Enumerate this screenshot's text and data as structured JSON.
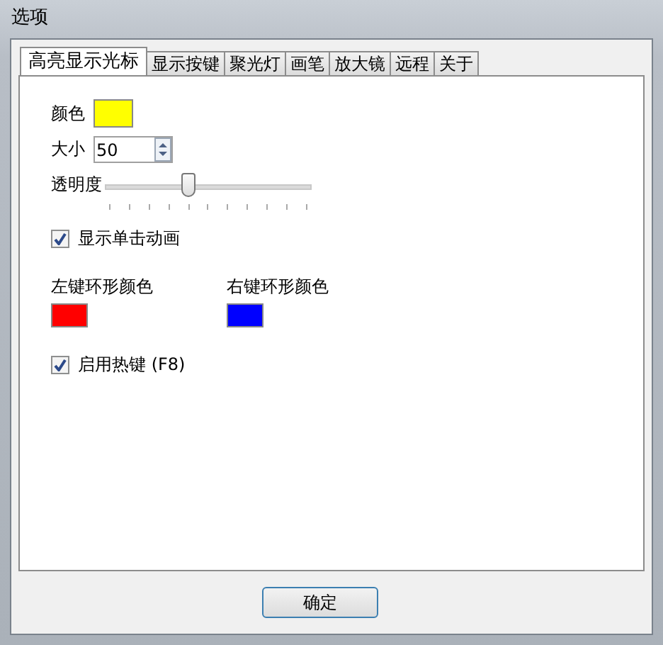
{
  "window": {
    "title": "选项"
  },
  "tabs": [
    {
      "label": "高亮显示光标",
      "selected": true
    },
    {
      "label": "显示按键",
      "selected": false
    },
    {
      "label": "聚光灯",
      "selected": false
    },
    {
      "label": "画笔",
      "selected": false
    },
    {
      "label": "放大镜",
      "selected": false
    },
    {
      "label": "远程",
      "selected": false
    },
    {
      "label": "关于",
      "selected": false
    }
  ],
  "color": {
    "label": "颜色",
    "color": "#ffff00"
  },
  "size": {
    "label": "大小",
    "value": "50"
  },
  "opacity": {
    "label": "透明度",
    "level": 0.4
  },
  "click_animation": {
    "label": "显示单击动画",
    "checked": true
  },
  "ring_colors": [
    {
      "label": "左键环形颜色",
      "color": "#ff0000"
    },
    {
      "label": "右键环形颜色",
      "color": "#0000ff"
    }
  ],
  "hotkey": {
    "label": "启用热键 (F8)",
    "checked": true
  },
  "buttons": [
    "确定"
  ]
}
